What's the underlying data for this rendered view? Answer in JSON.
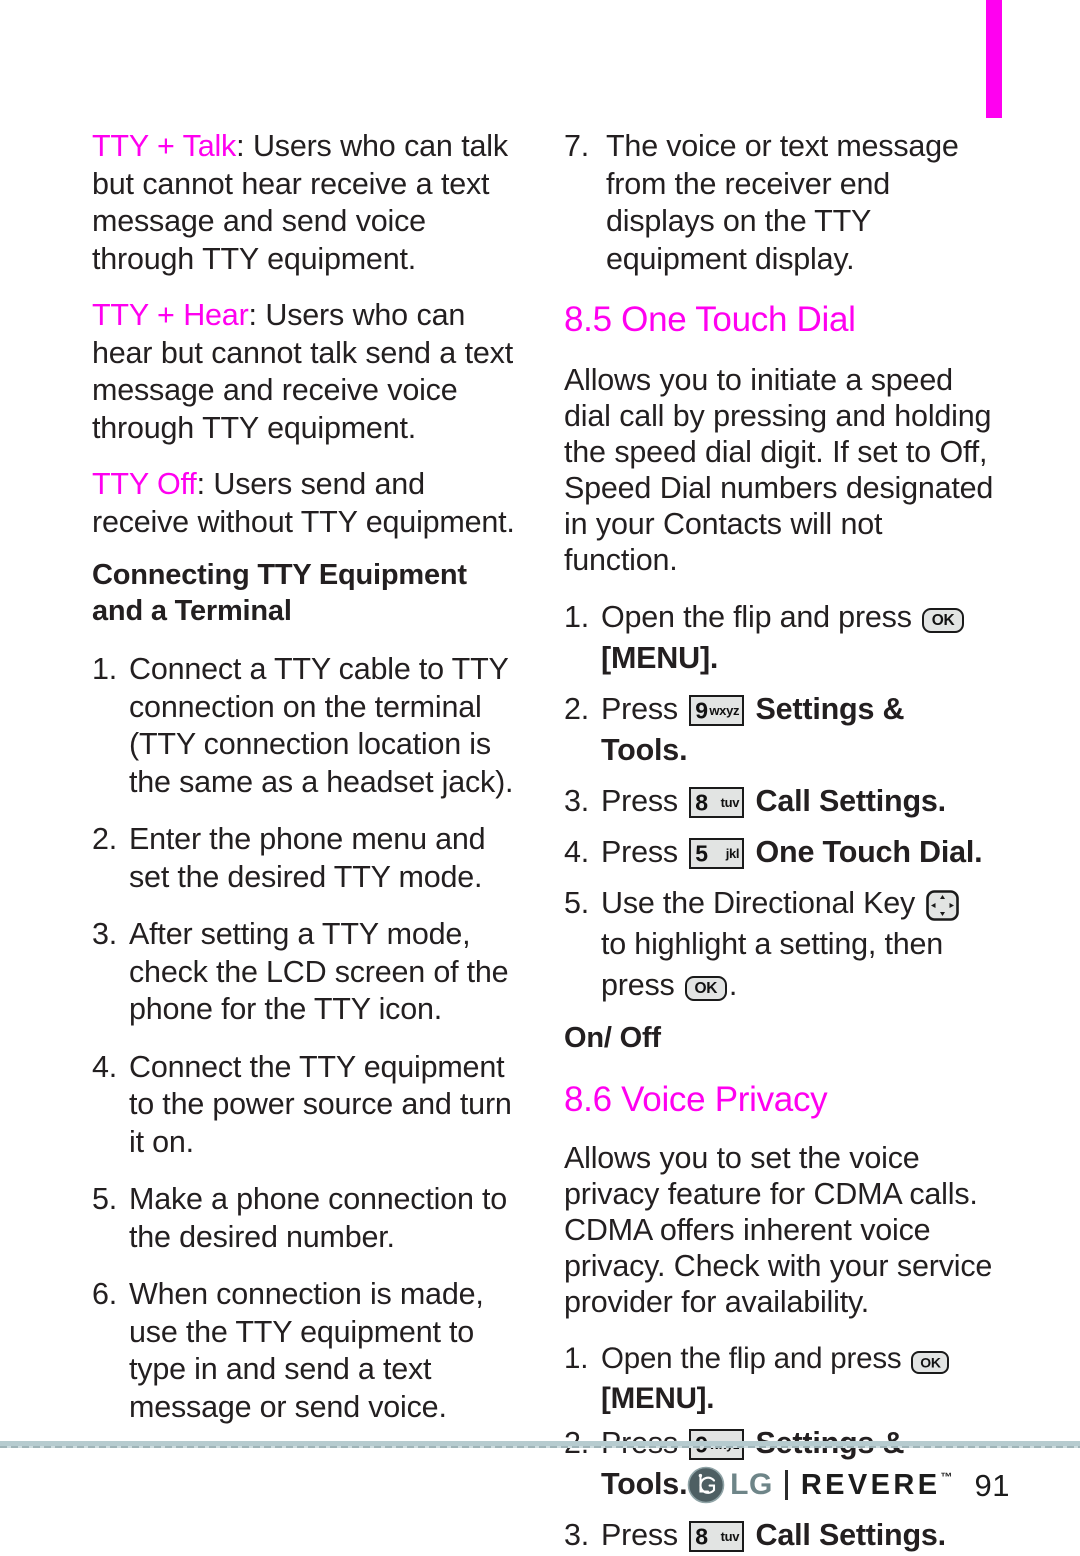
{
  "page": {
    "number": "91",
    "tab_color": "#ff00f0",
    "accent_color": "#ff00f0",
    "rule_color": "#b6cbcf"
  },
  "footer": {
    "brand": "LG",
    "product": "REVERE",
    "trademark": "™",
    "page_number": "91"
  },
  "left_column": {
    "defs": [
      {
        "term": "TTY + Talk",
        "body": ": Users who can talk but cannot hear receive a text message and send voice through TTY equipment."
      },
      {
        "term": "TTY + Hear",
        "body": ": Users who can hear but cannot talk send a text message and receive voice through TTY equipment."
      },
      {
        "term": "TTY Off",
        "body": ": Users send and receive without TTY equipment."
      }
    ],
    "subhead": "Connecting TTY Equipment and a Terminal",
    "steps": [
      {
        "num": "1.",
        "text": "Connect a TTY cable to TTY connection on the terminal (TTY connection location is the same as a headset jack)."
      },
      {
        "num": "2.",
        "text": "Enter the phone menu and set the desired TTY mode."
      },
      {
        "num": "3.",
        "text": "After setting a TTY mode, check the LCD screen of the phone for the TTY icon."
      },
      {
        "num": "4.",
        "text": "Connect the TTY equipment to the power source and turn it on."
      },
      {
        "num": "5.",
        "text": "Make a phone connection to the desired number."
      },
      {
        "num": "6.",
        "text": "When connection is made, use the TTY equipment to type in and send a text message or send voice."
      }
    ]
  },
  "right_column": {
    "step7": {
      "num": "7.",
      "text": "The voice or text message from the receiver end displays on the TTY equipment display."
    },
    "one_touch_dial": {
      "heading": "8.5 One Touch Dial",
      "body": "Allows you to initiate a speed dial call by pressing and holding the speed dial digit. If set to Off, Speed Dial numbers designated in your Contacts will not function.",
      "steps": [
        {
          "num": "1.",
          "pre": "Open the flip and press",
          "key": {
            "type": "ok",
            "label": "OK",
            "name": "ok-key-icon"
          },
          "post": "[MENU]."
        },
        {
          "num": "2.",
          "pre": "Press",
          "key": {
            "type": "number",
            "digit": "9",
            "letters": "wxyz",
            "name": "key-9-wxyz-icon"
          },
          "post": "Settings & Tools.",
          "post_bold": true
        },
        {
          "num": "3.",
          "pre": "Press",
          "key": {
            "type": "number",
            "digit": "8",
            "letters": "tuv",
            "name": "key-8-tuv-icon"
          },
          "post": "Call Settings.",
          "post_bold": true
        },
        {
          "num": "4.",
          "pre": "Press",
          "key": {
            "type": "number",
            "digit": "5",
            "letters": "jkl",
            "name": "key-5-jkl-icon"
          },
          "post": "One Touch Dial.",
          "post_bold": true
        },
        {
          "num": "5.",
          "pre": "Use the Directional Key",
          "key": {
            "type": "directional",
            "name": "directional-key-icon"
          },
          "mid": "to highlight a setting, then press",
          "key2": {
            "type": "ok",
            "label": "OK",
            "name": "ok-key-icon"
          },
          "post": "."
        }
      ],
      "on_off_subhead": "On/ Off"
    },
    "voice_privacy": {
      "heading": "8.6 Voice Privacy",
      "body": "Allows you to set the voice privacy feature for CDMA calls. CDMA offers inherent voice privacy. Check with your service provider for availability.",
      "steps": [
        {
          "num": "1.",
          "pre": "Open the flip and press",
          "key": {
            "type": "ok",
            "label": "OK",
            "name": "ok-key-icon"
          },
          "post": "[MENU]."
        },
        {
          "num": "2.",
          "pre": "Press",
          "key": {
            "type": "number",
            "digit": "9",
            "letters": "wxyz",
            "name": "key-9-wxyz-icon"
          },
          "post": "Settings & Tools.",
          "post_bold": true
        },
        {
          "num": "3.",
          "pre": "Press",
          "key": {
            "type": "number",
            "digit": "8",
            "letters": "tuv",
            "name": "key-8-tuv-icon"
          },
          "post": "Call Settings.",
          "post_bold": true
        }
      ]
    }
  }
}
